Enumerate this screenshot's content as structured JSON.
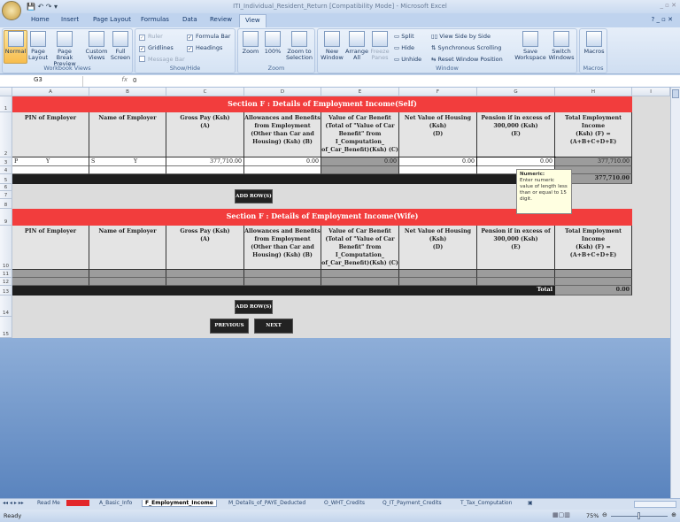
{
  "app": {
    "title": "ITI_Individual_Resident_Return  [Compatibility Mode]  -  Microsoft Excel"
  },
  "ribbon_tabs": [
    "Home",
    "Insert",
    "Page Layout",
    "Formulas",
    "Data",
    "Review",
    "View"
  ],
  "active_tab": "View",
  "ribbon": {
    "workbook_views": {
      "label": "Workbook Views",
      "buttons": [
        "Normal",
        "Page Layout",
        "Page Break Preview",
        "Custom Views",
        "Full Screen"
      ]
    },
    "show_hide": {
      "label": "Show/Hide",
      "checks": [
        {
          "label": "Ruler",
          "checked": true,
          "enabled": false
        },
        {
          "label": "Formula Bar",
          "checked": true,
          "enabled": true
        },
        {
          "label": "Gridlines",
          "checked": true,
          "enabled": true
        },
        {
          "label": "Headings",
          "checked": true,
          "enabled": true
        },
        {
          "label": "Message Bar",
          "checked": false,
          "enabled": false
        }
      ]
    },
    "zoom": {
      "label": "Zoom",
      "buttons": [
        "Zoom",
        "100%",
        "Zoom to Selection"
      ]
    },
    "window": {
      "label": "Window",
      "buttons": [
        "New Window",
        "Arrange All",
        "Freeze Panes"
      ],
      "small": [
        "Split",
        "Hide",
        "Unhide",
        "View Side by Side",
        "Synchronous Scrolling",
        "Reset Window Position"
      ],
      "big2": [
        "Save Workspace",
        "Switch Windows"
      ]
    },
    "macros": {
      "label": "Macros",
      "buttons": [
        "Macros"
      ]
    }
  },
  "formula_bar": {
    "name_box": "G3",
    "fx": "fx",
    "value": "0"
  },
  "columns": [
    "A",
    "B",
    "C",
    "D",
    "E",
    "F",
    "G",
    "H",
    "I"
  ],
  "rows": [
    "1",
    "2",
    "3",
    "4",
    "5",
    "6",
    "7",
    "8",
    "9",
    "10",
    "11",
    "12",
    "13",
    "14",
    "15"
  ],
  "self": {
    "title": "Section F : Details of Employment Income(Self)",
    "headers": [
      "PIN of Employer",
      "Name of Employer",
      "Gross Pay (Ksh)\n(A)",
      "Allowances and Benefits from Employment (Other than Car and Housing) (Ksh) (B)",
      "Value of Car Benefit (Total of \"Value of Car Benefit\" from I_Computation_ of_Car_Benefit)(Ksh) (C)",
      "Net Value of Housing (Ksh)\n(D)",
      "Pension if in excess of 300,000 (Ksh)\n(E)",
      "Total Employment Income\n(Ksh) (F) = (A+B+C+D+E)"
    ],
    "row3": {
      "pin_a": "P",
      "pin_b": "Y",
      "name_a": "S",
      "name_b": "Y",
      "gross": "377,710.00",
      "allow": "0.00",
      "car": "0.00",
      "housing": "0.00",
      "pension": "0.00",
      "total": "377,710.00"
    },
    "total": "377,710.00",
    "add_rows": "ADD ROW(S)"
  },
  "wife": {
    "title": "Section F : Details of Employment Income(Wife)",
    "total_label": "Total",
    "total": "0.00",
    "add_rows": "ADD ROW(S)"
  },
  "nav": {
    "previous": "PREVIOUS",
    "next": "NEXT"
  },
  "tooltip": {
    "title": "Numeric:",
    "body": "Enter numeric value of length less than or equal to 15 digit."
  },
  "sheet_tabs": [
    "Read Me",
    "Errors",
    "A_Basic_Info",
    "F_Employment_Income",
    "M_Details_of_PAYE_Deducted",
    "O_WHT_Credits",
    "Q_IT_Payment_Credits",
    "T_Tax_Computation"
  ],
  "active_sheet": "F_Employment_Income",
  "status": {
    "text": "Ready",
    "zoom": "75%"
  },
  "colors": {
    "section_red": "#f23d3d",
    "ribbon_blue": "#cfdef1",
    "dark_band": "#1e1e1e"
  }
}
